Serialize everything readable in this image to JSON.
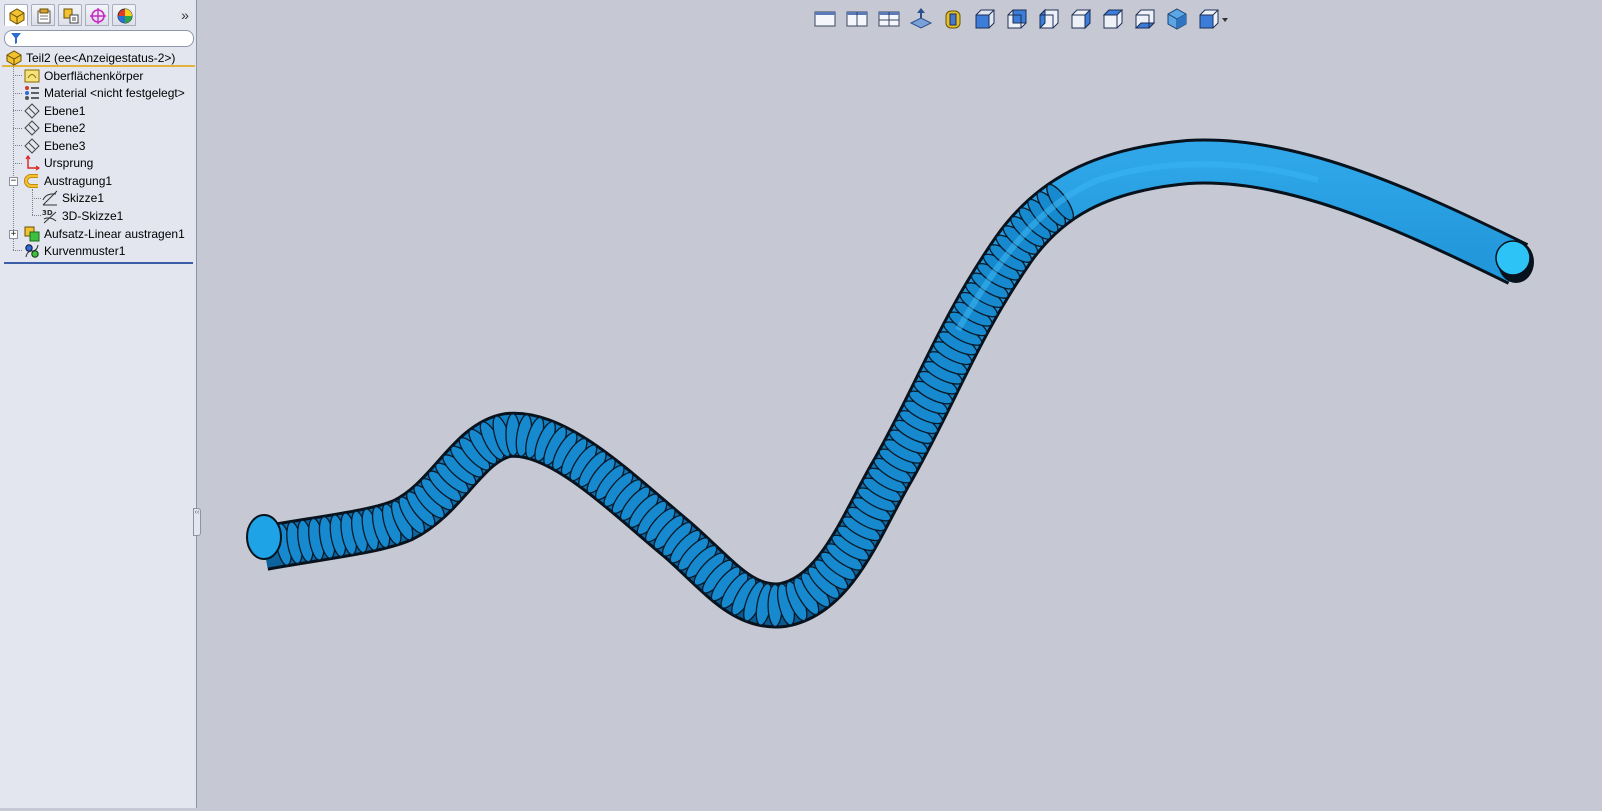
{
  "panel": {
    "tabs": [
      {
        "name": "feature-manager-tab-icon",
        "active": true
      },
      {
        "name": "property-manager-tab-icon",
        "active": false
      },
      {
        "name": "configuration-manager-tab-icon",
        "active": false
      },
      {
        "name": "dimxpert-manager-tab-icon",
        "active": false
      },
      {
        "name": "display-manager-tab-icon",
        "active": false
      }
    ],
    "expand_glyph": "»",
    "filter": {
      "value": "",
      "placeholder": ""
    },
    "root_label": "Teil2  (ee<Anzeigestatus-2>)",
    "tree": [
      {
        "label": "Oberflächenkörper",
        "icon": "surface-bodies-icon",
        "level": 1
      },
      {
        "label": "Material <nicht festgelegt>",
        "icon": "material-icon",
        "level": 1
      },
      {
        "label": "Ebene1",
        "icon": "plane-icon",
        "level": 1
      },
      {
        "label": "Ebene2",
        "icon": "plane-icon",
        "level": 1
      },
      {
        "label": "Ebene3",
        "icon": "plane-icon",
        "level": 1
      },
      {
        "label": "Ursprung",
        "icon": "origin-icon",
        "level": 1
      },
      {
        "label": "Austragung1",
        "icon": "sweep-icon",
        "level": 1,
        "expander": "−"
      },
      {
        "label": "Skizze1",
        "icon": "sketch-icon",
        "level": 2
      },
      {
        "label": "3D-Skizze1",
        "icon": "3d-sketch-icon",
        "level": 2
      },
      {
        "label": "Aufsatz-Linear austragen1",
        "icon": "loft-icon",
        "level": 1,
        "expander": "+"
      },
      {
        "label": "Kurvenmuster1",
        "icon": "curve-pattern-icon",
        "level": 1
      }
    ]
  },
  "grip_glyph": "‹‹",
  "hud": [
    "single-view-icon",
    "two-view-icon",
    "four-view-icon",
    "section-view-icon",
    "zoom-fit-icon",
    "view-front-icon",
    "view-back-icon",
    "view-left-icon",
    "view-right-icon",
    "view-top-icon",
    "view-bottom-icon",
    "display-style-icon",
    "view-orientation-icon"
  ],
  "colors": {
    "background": "#c6c9d3",
    "part_blue": "#1b8fd6",
    "part_shade": "#0b5e96",
    "end_face": "#2ec3f6",
    "panel_bg": "#e3e6ef"
  }
}
